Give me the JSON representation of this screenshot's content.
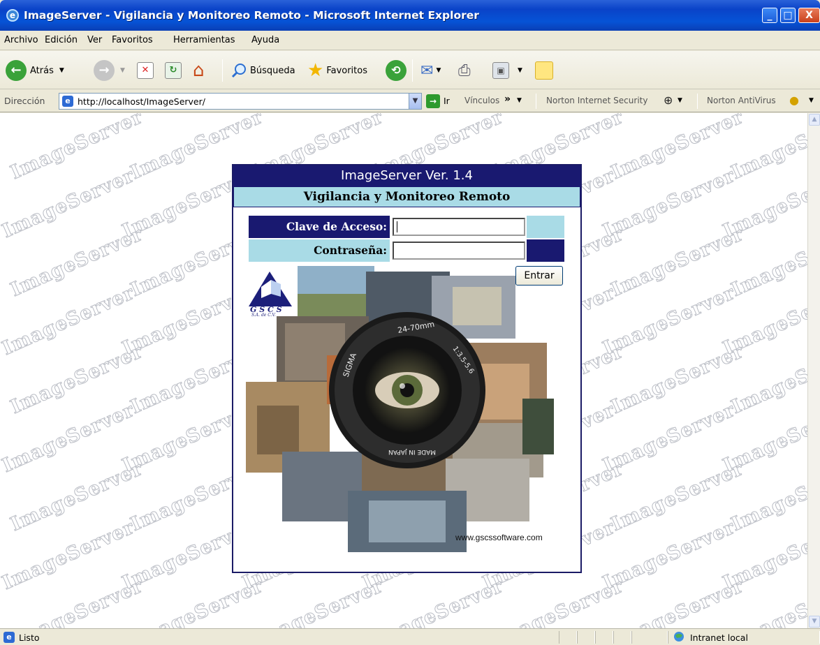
{
  "window": {
    "title": "ImageServer - Vigilancia y Monitoreo Remoto - Microsoft Internet Explorer",
    "minimize": "_",
    "maximize": "□",
    "close": "X"
  },
  "menu": [
    "Archivo",
    "Edición",
    "Ver",
    "Favoritos",
    "Herramientas",
    "Ayuda"
  ],
  "toolbar": {
    "back": "Atrás",
    "search": "Búsqueda",
    "favorites": "Favoritos"
  },
  "address": {
    "label": "Dirección",
    "url": "http://localhost/ImageServer/",
    "go": "Ir",
    "links": "Vínculos",
    "links_chevron": "»",
    "norton_is": "Norton Internet Security",
    "norton_av": "Norton AntiVirus"
  },
  "page": {
    "watermark": "ImageServer",
    "title": "ImageServer Ver. 1.4",
    "subtitle": "Vigilancia y Monitoreo Remoto",
    "user_label": "Clave de Acceso:",
    "user_value": "",
    "password_label": "Contraseña:",
    "password_value": "",
    "enter_button": "Entrar",
    "company_url": "www.gscssoftware.com",
    "logo_letters": "G S C S",
    "logo_sub": "S.A. de C.V."
  },
  "status": {
    "text": "Listo",
    "zone": "Intranet local"
  },
  "colors": {
    "panel_navy": "#191970",
    "panel_light": "#a9dbe6",
    "title_blue": "#0a43c8"
  }
}
